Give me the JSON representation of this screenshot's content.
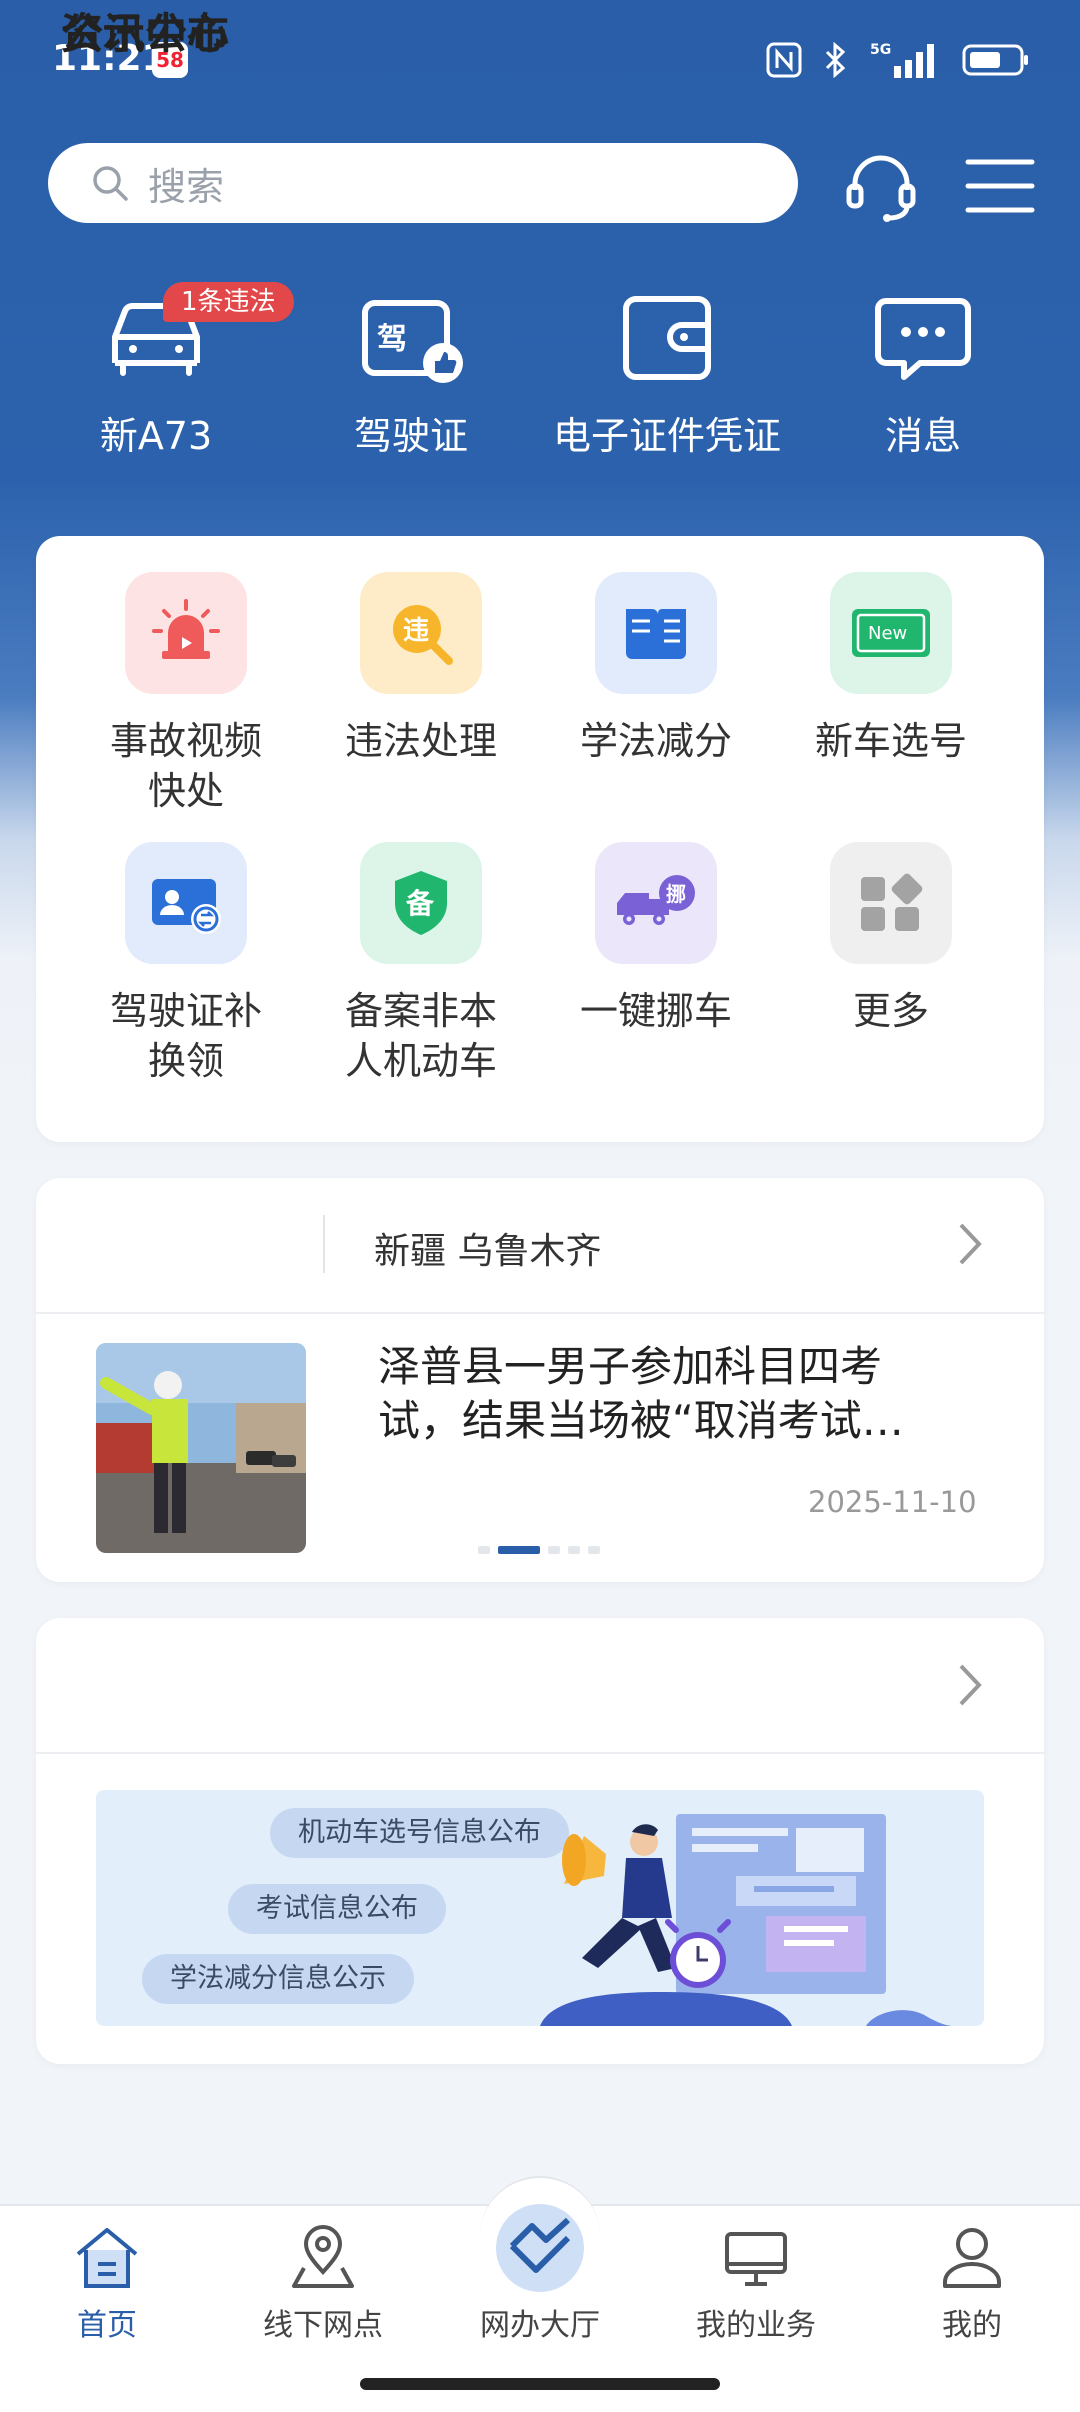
{
  "status_bar": {
    "time": "11:21",
    "app_badge": "58",
    "network": "5G"
  },
  "search": {
    "placeholder": "搜索"
  },
  "header_icons": [
    "headset-icon",
    "menu-icon"
  ],
  "shortcuts": [
    {
      "label": "新A73",
      "icon": "car-icon",
      "badge": "1条违法"
    },
    {
      "label": "驾驶证",
      "icon": "license-icon"
    },
    {
      "label": "电子证件凭证",
      "icon": "wallet-icon"
    },
    {
      "label": "消息",
      "icon": "message-icon"
    }
  ],
  "services": [
    {
      "label": "事故视频快处",
      "icon": "alarm-light-icon",
      "tile_color": "#fde3e3"
    },
    {
      "label": "违法处理",
      "icon": "violation-search-icon",
      "tile_color": "#fdecc7"
    },
    {
      "label": "学法减分",
      "icon": "book-icon",
      "tile_color": "#e1ebfb"
    },
    {
      "label": "新车选号",
      "icon": "new-plate-icon",
      "tile_color": "#dcf5e8"
    },
    {
      "label": "驾驶证补换领",
      "icon": "id-card-renew-icon",
      "tile_color": "#e1ebfb"
    },
    {
      "label": "备案非本人机动车",
      "icon": "shield-record-icon",
      "tile_color": "#dcf5e8"
    },
    {
      "label": "一键挪车",
      "icon": "truck-move-icon",
      "tile_color": "#ebe6fa"
    },
    {
      "label": "更多",
      "icon": "grid-more-icon",
      "tile_color": "#efefef"
    }
  ],
  "news": {
    "title": "资讯中心",
    "region": "新疆 乌鲁木齐",
    "headline": "泽普县一男子参加科目四考试，结果当场被“取消考试…",
    "date": "2025-11-10",
    "carousel_count": 5,
    "carousel_active": 2
  },
  "notice": {
    "title": "公示公布",
    "pills": [
      "机动车选号信息公布",
      "考试信息公布",
      "学法减分信息公示"
    ]
  },
  "bottom_nav": [
    {
      "label": "首页",
      "icon": "home-icon",
      "active": true
    },
    {
      "label": "线下网点",
      "icon": "map-pin-icon",
      "active": false
    },
    {
      "label": "网办大厅",
      "icon": "handshake-icon",
      "active": false
    },
    {
      "label": "我的业务",
      "icon": "monitor-icon",
      "active": false
    },
    {
      "label": "我的",
      "icon": "user-icon",
      "active": false
    }
  ],
  "colors": {
    "brand": "#2a5ea8",
    "badge_red": "#e2484a",
    "background": "#f1f4f8"
  }
}
